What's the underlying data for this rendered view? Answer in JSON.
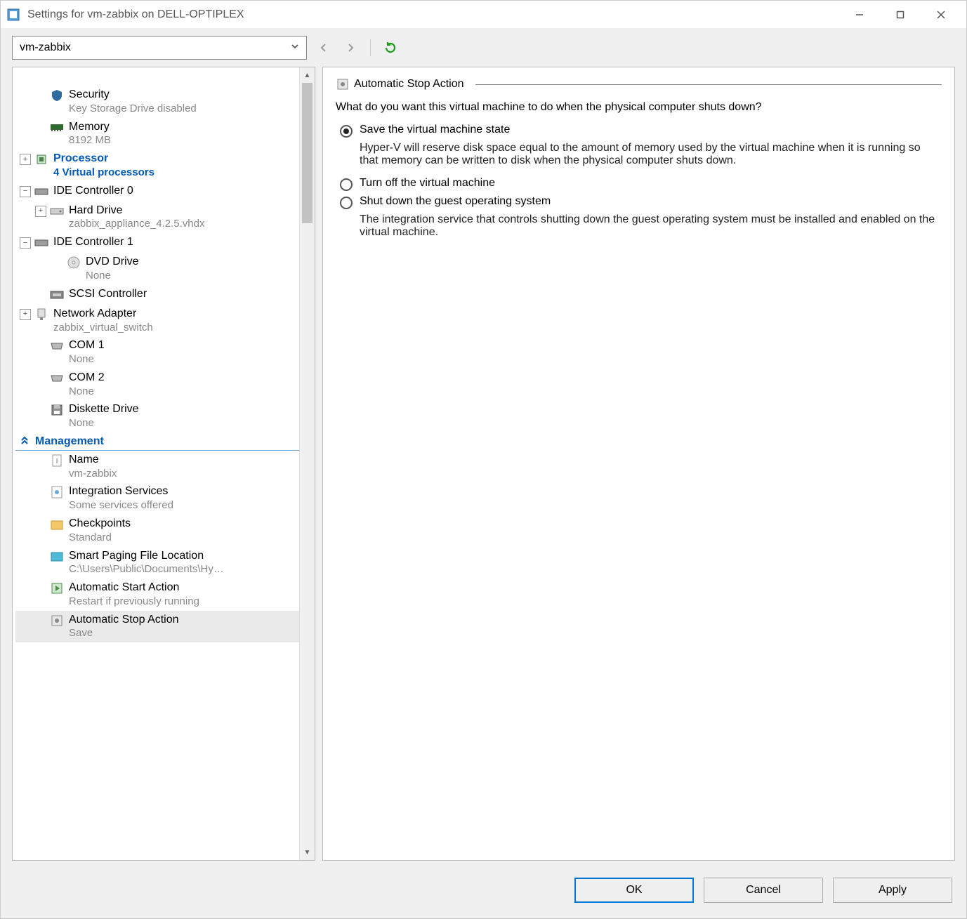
{
  "window_title": "Settings for vm-zabbix on DELL-OPTIPLEX",
  "vm_selector": {
    "selected": "vm-zabbix"
  },
  "tree": {
    "security": {
      "label": "Security",
      "sub": "Key Storage Drive disabled"
    },
    "memory": {
      "label": "Memory",
      "sub": "8192 MB"
    },
    "processor": {
      "label": "Processor",
      "sub": "4 Virtual processors"
    },
    "ide0": {
      "label": "IDE Controller 0"
    },
    "hdd": {
      "label": "Hard Drive",
      "sub": "zabbix_appliance_4.2.5.vhdx"
    },
    "ide1": {
      "label": "IDE Controller 1"
    },
    "dvd": {
      "label": "DVD Drive",
      "sub": "None"
    },
    "scsi": {
      "label": "SCSI Controller"
    },
    "net": {
      "label": "Network Adapter",
      "sub": "zabbix_virtual_switch"
    },
    "com1": {
      "label": "COM 1",
      "sub": "None"
    },
    "com2": {
      "label": "COM 2",
      "sub": "None"
    },
    "diskette": {
      "label": "Diskette Drive",
      "sub": "None"
    },
    "management_section": "Management",
    "name": {
      "label": "Name",
      "sub": "vm-zabbix"
    },
    "integration": {
      "label": "Integration Services",
      "sub": "Some services offered"
    },
    "checkpoints": {
      "label": "Checkpoints",
      "sub": "Standard"
    },
    "smartpaging": {
      "label": "Smart Paging File Location",
      "sub": "C:\\Users\\Public\\Documents\\Hy…"
    },
    "autostart": {
      "label": "Automatic Start Action",
      "sub": "Restart if previously running"
    },
    "autostop": {
      "label": "Automatic Stop Action",
      "sub": "Save"
    }
  },
  "content": {
    "header": "Automatic Stop Action",
    "question": "What do you want this virtual machine to do when the physical computer shuts down?",
    "options": {
      "save": {
        "label": "Save the virtual machine state",
        "desc": "Hyper-V will reserve disk space equal to the amount of memory used by the virtual machine when it is running so that memory can be written to disk when the physical computer shuts down."
      },
      "turnoff": {
        "label": "Turn off the virtual machine"
      },
      "shutdown": {
        "label": "Shut down the guest operating system",
        "desc": "The integration service that controls shutting down the guest operating system must be installed and enabled on the virtual machine."
      }
    },
    "selected_option": "save"
  },
  "buttons": {
    "ok": "OK",
    "cancel": "Cancel",
    "apply": "Apply"
  }
}
